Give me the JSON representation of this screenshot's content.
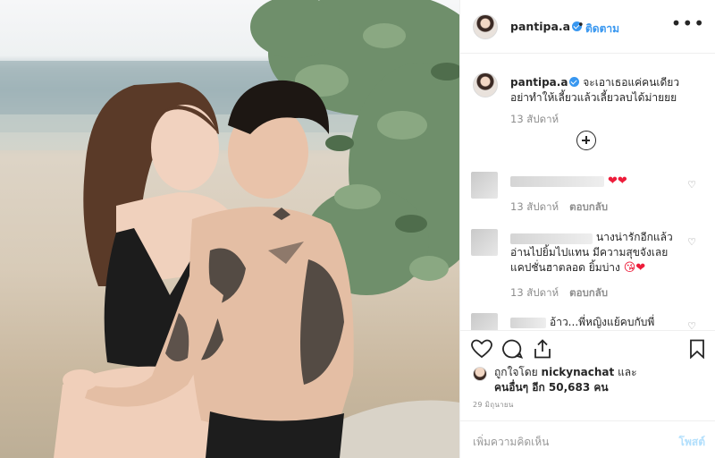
{
  "post": {
    "username": "pantipa.a",
    "follow_label": "ติดตาม",
    "more_label": "•••",
    "caption_line1": "จะเอาเธอแค่คนเดียว",
    "caption_line2": "อย่าทำให้เลี้ยวแล้วเลี้ยวลบได้ม่ายยย",
    "caption_time": "13 สัปดาห์",
    "load_more_icon": "plus-circle-icon"
  },
  "comments": [
    {
      "text": "❤❤",
      "time": "13 สัปดาห์",
      "reply": "ตอบกลับ"
    },
    {
      "line1": "นางน่ารักอีกแล้ว",
      "line2": "อ่านไปยิ้มไปแทน มีความสุขจังเลย",
      "line3": "แคปชั่นฮาตลอด ยิ้มบ่าง",
      "emoji": "😘❤",
      "time": "13 สัปดาห์",
      "reply": "ตอบกลับ"
    },
    {
      "text": "อ้าว...พี่หญิงแย้คบกับพี่"
    }
  ],
  "likes": {
    "prefix": "ถูกใจโดย",
    "user": "nickynachat",
    "and": "และ",
    "others": "คนอื่นๆ อีก 50,683 คน"
  },
  "date": "29 มิถุนายน",
  "add_comment": {
    "placeholder": "เพิ่มความคิดเห็น",
    "post_label": "โพสต์"
  },
  "colors": {
    "accent": "#3897f0",
    "heart": "#ed1c3a",
    "text": "#262626",
    "muted": "#8e8e8e"
  }
}
